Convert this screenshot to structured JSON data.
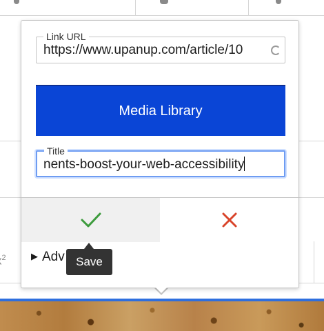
{
  "link_form": {
    "url_field": {
      "label": "Link URL",
      "value": "https://www.upanup.com/article/10"
    },
    "media_library_label": "Media Library",
    "title_field": {
      "label": "Title",
      "value": "nents-boost-your-web-accessibility"
    },
    "advanced_label": "Adv",
    "save_tooltip": "Save"
  },
  "background": {
    "superscript_label": "x",
    "superscript_exponent": "2"
  },
  "colors": {
    "primary_button": "#0a45d6",
    "save_check": "#3c9b3c",
    "cancel_x": "#d9452b",
    "focus_ring": "#6e9cf2"
  },
  "icons": {
    "save": "check-icon",
    "cancel": "close-icon",
    "advanced_toggle": "triangle-right-icon",
    "superscript": "superscript-icon"
  }
}
